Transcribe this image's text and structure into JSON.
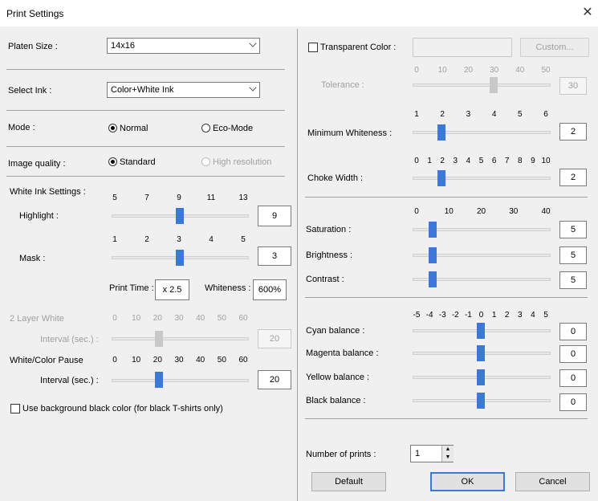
{
  "window": {
    "title": "Print Settings"
  },
  "platen": {
    "label": "Platen Size :",
    "value": "14x16"
  },
  "ink": {
    "label": "Select Ink :",
    "value": "Color+White Ink"
  },
  "mode": {
    "label": "Mode :",
    "normal": "Normal",
    "eco": "Eco-Mode",
    "selected": "Normal"
  },
  "quality": {
    "label": "Image quality :",
    "standard": "Standard",
    "high": "High resolution",
    "selected": "Standard"
  },
  "white_ink": {
    "label": "White Ink Settings :",
    "highlight": {
      "label": "Highlight :",
      "ticks": [
        "5",
        "7",
        "9",
        "11",
        "13"
      ],
      "value": "9"
    },
    "mask": {
      "label": "Mask :",
      "ticks": [
        "1",
        "2",
        "3",
        "4",
        "5"
      ],
      "value": "3"
    },
    "print_time_label": "Print Time :",
    "print_time": "x 2.5",
    "whiteness_label": "Whiteness :",
    "whiteness": "600%"
  },
  "two_layer": {
    "label": "2 Layer White",
    "interval_label": "Interval (sec.) :",
    "ticks": [
      "0",
      "10",
      "20",
      "30",
      "40",
      "50",
      "60"
    ],
    "value": "20"
  },
  "pause": {
    "label": "White/Color Pause",
    "interval_label": "Interval (sec.) :",
    "ticks": [
      "0",
      "10",
      "20",
      "30",
      "40",
      "50",
      "60"
    ],
    "value": "20"
  },
  "black_bg": {
    "label": "Use background black color (for black T-shirts only)",
    "checked": false
  },
  "transparent": {
    "label": "Transparent Color :",
    "checked": false,
    "custom_label": "Custom..."
  },
  "tolerance": {
    "label": "Tolerance :",
    "ticks": [
      "0",
      "10",
      "20",
      "30",
      "40",
      "50"
    ],
    "value": "30"
  },
  "min_white": {
    "label": "Minimum Whiteness :",
    "ticks": [
      "1",
      "2",
      "3",
      "4",
      "5",
      "6"
    ],
    "value": "2"
  },
  "choke": {
    "label": "Choke Width :",
    "ticks": [
      "0",
      "1",
      "2",
      "3",
      "4",
      "5",
      "6",
      "7",
      "8",
      "9",
      "10"
    ],
    "value": "2"
  },
  "sbc_ticks": [
    "0",
    "10",
    "20",
    "30",
    "40"
  ],
  "saturation": {
    "label": "Saturation :",
    "value": "5"
  },
  "brightness": {
    "label": "Brightness :",
    "value": "5"
  },
  "contrast": {
    "label": "Contrast :",
    "value": "5"
  },
  "balance_ticks": [
    "-5",
    "-4",
    "-3",
    "-2",
    "-1",
    "0",
    "1",
    "2",
    "3",
    "4",
    "5"
  ],
  "cyan": {
    "label": "Cyan balance :",
    "value": "0"
  },
  "magenta": {
    "label": "Magenta balance :",
    "value": "0"
  },
  "yellow": {
    "label": "Yellow balance :",
    "value": "0"
  },
  "black": {
    "label": "Black balance :",
    "value": "0"
  },
  "prints": {
    "label": "Number of prints :",
    "value": "1"
  },
  "buttons": {
    "default": "Default",
    "ok": "OK",
    "cancel": "Cancel"
  },
  "colors": {
    "accent": "#3c78d8",
    "background": "#f0f0f0"
  }
}
